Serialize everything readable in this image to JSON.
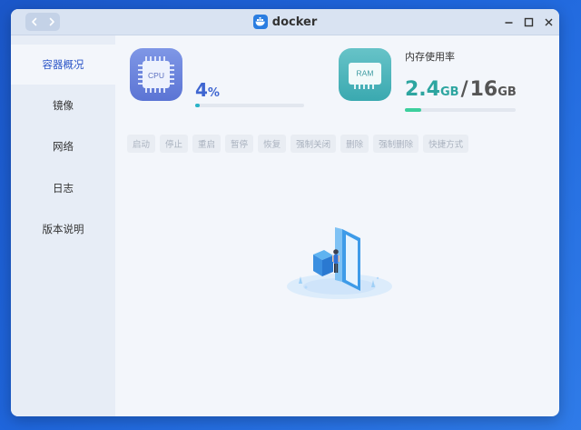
{
  "window": {
    "title": "docker"
  },
  "sidebar": {
    "items": [
      {
        "label": "容器概况",
        "active": true
      },
      {
        "label": "镜像"
      },
      {
        "label": "网络"
      },
      {
        "label": "日志"
      },
      {
        "label": "版本说明"
      }
    ]
  },
  "cpu": {
    "chip_label": "CPU",
    "value": "4",
    "unit": "%",
    "usage_percent": 4
  },
  "memory": {
    "label": "内存使用率",
    "chip_label": "RAM",
    "used": "2.4",
    "used_unit": "GB",
    "separator": "/",
    "total": "16",
    "total_unit": "GB",
    "usage_fraction": 0.15
  },
  "actions": [
    "启动",
    "停止",
    "重启",
    "暂停",
    "恢复",
    "强制关闭",
    "删除",
    "强制删除",
    "快捷方式"
  ],
  "icons": {
    "back": "chevron-left-icon",
    "forward": "chevron-right-icon",
    "app": "docker-whale-icon",
    "minimize": "minimize-icon",
    "maximize": "maximize-icon",
    "close": "close-icon"
  },
  "colors": {
    "accent": "#2e57c8",
    "cpu_bar": "#2bb3c7",
    "ram_bar": "#3ccf9d",
    "ram_value": "#2da5a0"
  }
}
